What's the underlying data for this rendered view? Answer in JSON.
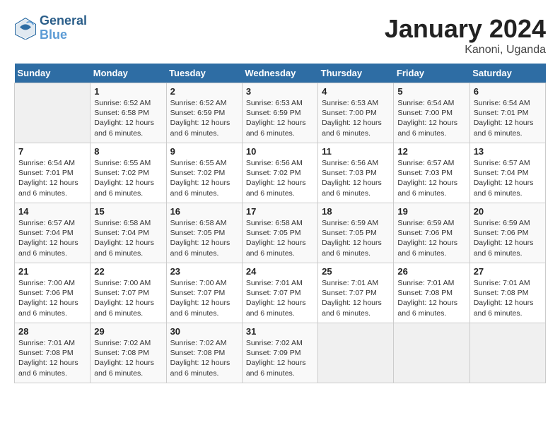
{
  "logo": {
    "line1": "General",
    "line2": "Blue"
  },
  "title": "January 2024",
  "subtitle": "Kanoni, Uganda",
  "header_days": [
    "Sunday",
    "Monday",
    "Tuesday",
    "Wednesday",
    "Thursday",
    "Friday",
    "Saturday"
  ],
  "weeks": [
    [
      {
        "day": "",
        "content": ""
      },
      {
        "day": "1",
        "content": "Sunrise: 6:52 AM\nSunset: 6:58 PM\nDaylight: 12 hours\nand 6 minutes."
      },
      {
        "day": "2",
        "content": "Sunrise: 6:52 AM\nSunset: 6:59 PM\nDaylight: 12 hours\nand 6 minutes."
      },
      {
        "day": "3",
        "content": "Sunrise: 6:53 AM\nSunset: 6:59 PM\nDaylight: 12 hours\nand 6 minutes."
      },
      {
        "day": "4",
        "content": "Sunrise: 6:53 AM\nSunset: 7:00 PM\nDaylight: 12 hours\nand 6 minutes."
      },
      {
        "day": "5",
        "content": "Sunrise: 6:54 AM\nSunset: 7:00 PM\nDaylight: 12 hours\nand 6 minutes."
      },
      {
        "day": "6",
        "content": "Sunrise: 6:54 AM\nSunset: 7:01 PM\nDaylight: 12 hours\nand 6 minutes."
      }
    ],
    [
      {
        "day": "7",
        "content": "Sunrise: 6:54 AM\nSunset: 7:01 PM\nDaylight: 12 hours\nand 6 minutes."
      },
      {
        "day": "8",
        "content": "Sunrise: 6:55 AM\nSunset: 7:02 PM\nDaylight: 12 hours\nand 6 minutes."
      },
      {
        "day": "9",
        "content": "Sunrise: 6:55 AM\nSunset: 7:02 PM\nDaylight: 12 hours\nand 6 minutes."
      },
      {
        "day": "10",
        "content": "Sunrise: 6:56 AM\nSunset: 7:02 PM\nDaylight: 12 hours\nand 6 minutes."
      },
      {
        "day": "11",
        "content": "Sunrise: 6:56 AM\nSunset: 7:03 PM\nDaylight: 12 hours\nand 6 minutes."
      },
      {
        "day": "12",
        "content": "Sunrise: 6:57 AM\nSunset: 7:03 PM\nDaylight: 12 hours\nand 6 minutes."
      },
      {
        "day": "13",
        "content": "Sunrise: 6:57 AM\nSunset: 7:04 PM\nDaylight: 12 hours\nand 6 minutes."
      }
    ],
    [
      {
        "day": "14",
        "content": "Sunrise: 6:57 AM\nSunset: 7:04 PM\nDaylight: 12 hours\nand 6 minutes."
      },
      {
        "day": "15",
        "content": "Sunrise: 6:58 AM\nSunset: 7:04 PM\nDaylight: 12 hours\nand 6 minutes."
      },
      {
        "day": "16",
        "content": "Sunrise: 6:58 AM\nSunset: 7:05 PM\nDaylight: 12 hours\nand 6 minutes."
      },
      {
        "day": "17",
        "content": "Sunrise: 6:58 AM\nSunset: 7:05 PM\nDaylight: 12 hours\nand 6 minutes."
      },
      {
        "day": "18",
        "content": "Sunrise: 6:59 AM\nSunset: 7:05 PM\nDaylight: 12 hours\nand 6 minutes."
      },
      {
        "day": "19",
        "content": "Sunrise: 6:59 AM\nSunset: 7:06 PM\nDaylight: 12 hours\nand 6 minutes."
      },
      {
        "day": "20",
        "content": "Sunrise: 6:59 AM\nSunset: 7:06 PM\nDaylight: 12 hours\nand 6 minutes."
      }
    ],
    [
      {
        "day": "21",
        "content": "Sunrise: 7:00 AM\nSunset: 7:06 PM\nDaylight: 12 hours\nand 6 minutes."
      },
      {
        "day": "22",
        "content": "Sunrise: 7:00 AM\nSunset: 7:07 PM\nDaylight: 12 hours\nand 6 minutes."
      },
      {
        "day": "23",
        "content": "Sunrise: 7:00 AM\nSunset: 7:07 PM\nDaylight: 12 hours\nand 6 minutes."
      },
      {
        "day": "24",
        "content": "Sunrise: 7:01 AM\nSunset: 7:07 PM\nDaylight: 12 hours\nand 6 minutes."
      },
      {
        "day": "25",
        "content": "Sunrise: 7:01 AM\nSunset: 7:07 PM\nDaylight: 12 hours\nand 6 minutes."
      },
      {
        "day": "26",
        "content": "Sunrise: 7:01 AM\nSunset: 7:08 PM\nDaylight: 12 hours\nand 6 minutes."
      },
      {
        "day": "27",
        "content": "Sunrise: 7:01 AM\nSunset: 7:08 PM\nDaylight: 12 hours\nand 6 minutes."
      }
    ],
    [
      {
        "day": "28",
        "content": "Sunrise: 7:01 AM\nSunset: 7:08 PM\nDaylight: 12 hours\nand 6 minutes."
      },
      {
        "day": "29",
        "content": "Sunrise: 7:02 AM\nSunset: 7:08 PM\nDaylight: 12 hours\nand 6 minutes."
      },
      {
        "day": "30",
        "content": "Sunrise: 7:02 AM\nSunset: 7:08 PM\nDaylight: 12 hours\nand 6 minutes."
      },
      {
        "day": "31",
        "content": "Sunrise: 7:02 AM\nSunset: 7:09 PM\nDaylight: 12 hours\nand 6 minutes."
      },
      {
        "day": "",
        "content": ""
      },
      {
        "day": "",
        "content": ""
      },
      {
        "day": "",
        "content": ""
      }
    ]
  ]
}
